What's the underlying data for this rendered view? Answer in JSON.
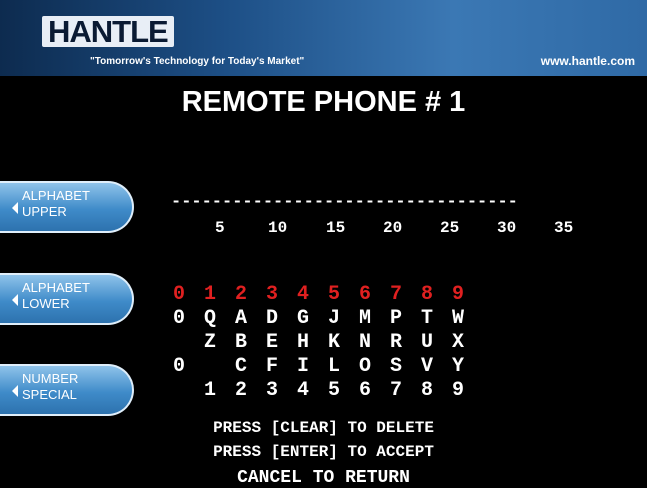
{
  "header": {
    "logo": "HANTLE",
    "tagline": "\"Tomorrow's Technology for Today's Market\"",
    "website": "www.hantle.com"
  },
  "title": "REMOTE PHONE # 1",
  "side_buttons": [
    {
      "label": "ALPHABET\nUPPER"
    },
    {
      "label": "ALPHABET\nLOWER"
    },
    {
      "label": "NUMBER\nSPECIAL"
    }
  ],
  "entry": {
    "dashes": "----------------------------------",
    "ticks": [
      "5",
      "10",
      "15",
      "20",
      "25",
      "30",
      "35"
    ]
  },
  "keypad": {
    "header_digits": [
      "0",
      "1",
      "2",
      "3",
      "4",
      "5",
      "6",
      "7",
      "8",
      "9"
    ],
    "rows": [
      [
        "0",
        "Q",
        "A",
        "D",
        "G",
        "J",
        "M",
        "P",
        "T",
        "W"
      ],
      [
        "",
        "Z",
        "B",
        "E",
        "H",
        "K",
        "N",
        "R",
        "U",
        "X"
      ],
      [
        "0",
        "",
        "C",
        "F",
        "I",
        "L",
        "O",
        "S",
        "V",
        "Y"
      ],
      [
        "",
        "1",
        "2",
        "3",
        "4",
        "5",
        "6",
        "7",
        "8",
        "9"
      ]
    ]
  },
  "instructions": {
    "clear": "PRESS [CLEAR] TO DELETE",
    "enter": "PRESS [ENTER] TO ACCEPT",
    "cancel": "CANCEL TO RETURN"
  },
  "colors": {
    "accent": "#e02020",
    "button": "#3f8bc9"
  }
}
